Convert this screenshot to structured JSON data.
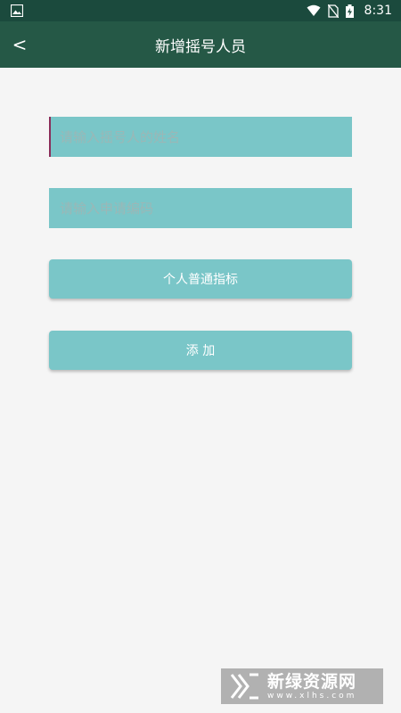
{
  "status_bar": {
    "time": "8:31",
    "left_icon": "image-icon",
    "right_icons": [
      "wifi-icon",
      "no-sim-icon",
      "battery-charging-icon"
    ]
  },
  "app_bar": {
    "back_label": "<",
    "title": "新增摇号人员"
  },
  "form": {
    "name_placeholder": "请输入摇号人的姓名",
    "name_value": "",
    "code_placeholder": "请输入申请编码",
    "code_value": "",
    "type_button_label": "个人普通指标",
    "add_button_label": "添 加"
  },
  "watermark": {
    "title": "新绿资源网",
    "subtitle": "www.xlhs.com"
  },
  "colors": {
    "status_bar": "#1b4a3d",
    "app_bar": "#255846",
    "field_bg": "#7ac6c8",
    "page_bg": "#f5f5f5",
    "cursor": "#8a2d5a"
  }
}
